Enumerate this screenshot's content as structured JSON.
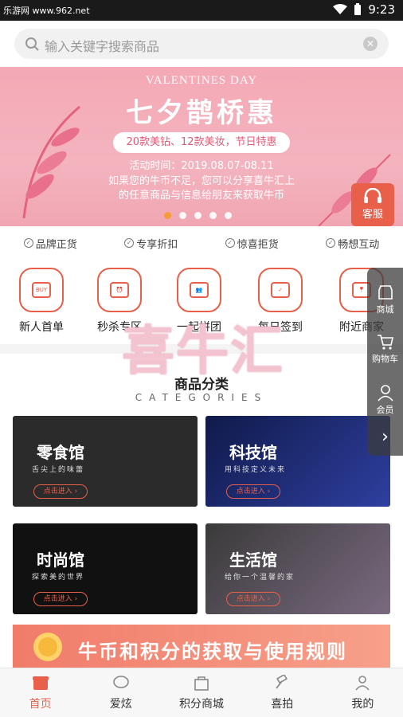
{
  "status": {
    "watermark": "乐游网 www.962.net",
    "time": "9:23"
  },
  "search": {
    "placeholder": "输入关键字搜索商品"
  },
  "banner": {
    "en": "VALENTINES DAY",
    "title": "七夕鹊桥惠",
    "pill": "20款美钻、12款美妆，节日特惠",
    "time": "活动时间：2019.08.07-08.11",
    "line1": "如果您的牛币不足，您可以分享喜牛汇上",
    "line2": "的任意商品与信息给朋友来获取牛币",
    "kefu": "客服"
  },
  "features": [
    "品牌正货",
    "专享折扣",
    "惊喜拒货",
    "畅想互动"
  ],
  "categories": [
    {
      "label": "新人首单",
      "mini": "BUY"
    },
    {
      "label": "秒杀专区",
      "mini": "⏰"
    },
    {
      "label": "一起拼团",
      "mini": "👥"
    },
    {
      "label": "每日签到",
      "mini": "✓"
    },
    {
      "label": "附近商家",
      "mini": "📍"
    }
  ],
  "brand_overlay": "喜牛汇",
  "section": {
    "title": "商品分类",
    "subtitle": "CATEGORIES"
  },
  "tiles": [
    {
      "title": "零食馆",
      "sub": "舌尖上的味蕾",
      "btn": "点击进入 ›",
      "bg": "#2b2b2b"
    },
    {
      "title": "科技馆",
      "sub": "用科技定义未来",
      "btn": "点击进入 ›",
      "bg": "#16225a"
    },
    {
      "title": "时尚馆",
      "sub": "探索美的世界",
      "btn": "点击进入 ›",
      "bg": "#111111"
    },
    {
      "title": "生活馆",
      "sub": "给你一个温馨的家",
      "btn": "点击进入 ›",
      "bg": "#4a4a4a"
    }
  ],
  "rules_banner": "牛币和积分的获取与使用规则",
  "float": {
    "mall": "商城",
    "cart": "购物车",
    "member": "会员"
  },
  "tabs": [
    "首页",
    "爱炫",
    "积分商城",
    "喜拍",
    "我的"
  ],
  "colors": {
    "accent": "#e8604a",
    "banner_pink": "#f4a9b5"
  }
}
